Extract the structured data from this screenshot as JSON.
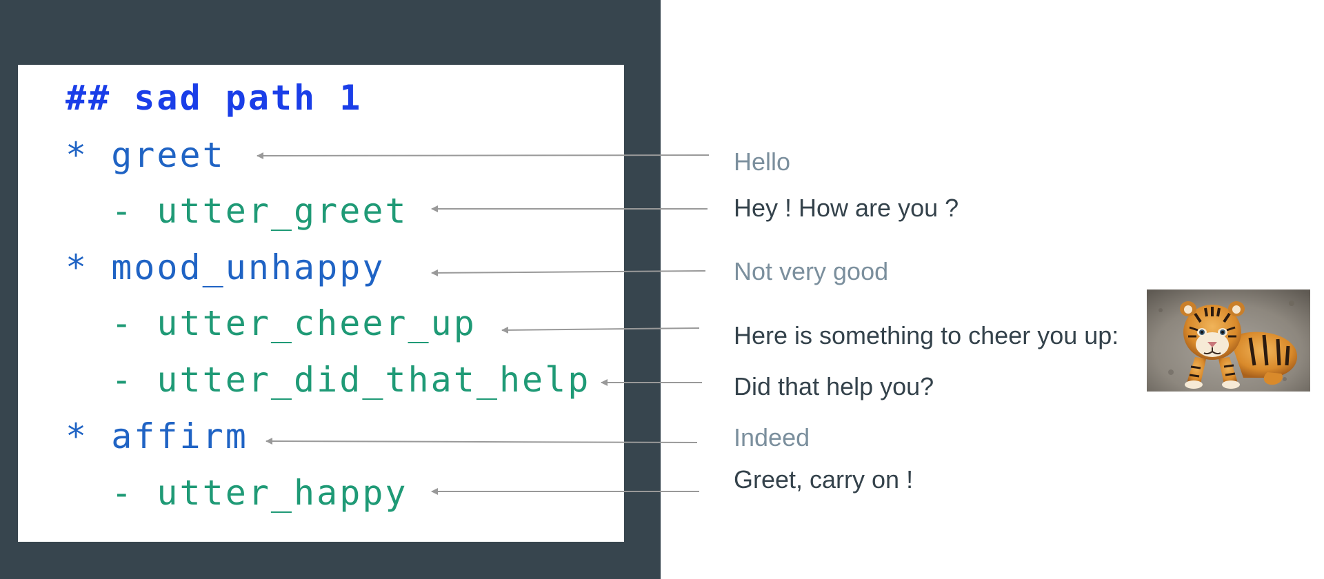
{
  "story": {
    "heading": "## sad path 1",
    "lines": [
      {
        "kind": "intent",
        "text": "* greet"
      },
      {
        "kind": "action",
        "text": "  - utter_greet"
      },
      {
        "kind": "intent",
        "text": "* mood_unhappy"
      },
      {
        "kind": "action",
        "text": "  - utter_cheer_up"
      },
      {
        "kind": "action",
        "text": "  - utter_did_that_help"
      },
      {
        "kind": "intent",
        "text": "* affirm"
      },
      {
        "kind": "action",
        "text": "  - utter_happy"
      }
    ]
  },
  "conversation": [
    {
      "speaker": "user",
      "text": "Hello"
    },
    {
      "speaker": "bot",
      "text": "Hey ! How are you ?"
    },
    {
      "speaker": "user",
      "text": "Not very good"
    },
    {
      "speaker": "bot",
      "text": "Here is something to cheer you up:"
    },
    {
      "speaker": "bot",
      "text": "Did that help you?"
    },
    {
      "speaker": "user",
      "text": "Indeed"
    },
    {
      "speaker": "bot",
      "text": "Greet, carry on !"
    }
  ],
  "image": {
    "icon": "tiger-cub-photo"
  },
  "colors": {
    "background_dark": "#37454e",
    "heading": "#1a3ee8",
    "intent": "#1f63c4",
    "action": "#1f9a76",
    "user_message": "#7b8f9d",
    "bot_message": "#34424b",
    "arrow": "#999999"
  }
}
